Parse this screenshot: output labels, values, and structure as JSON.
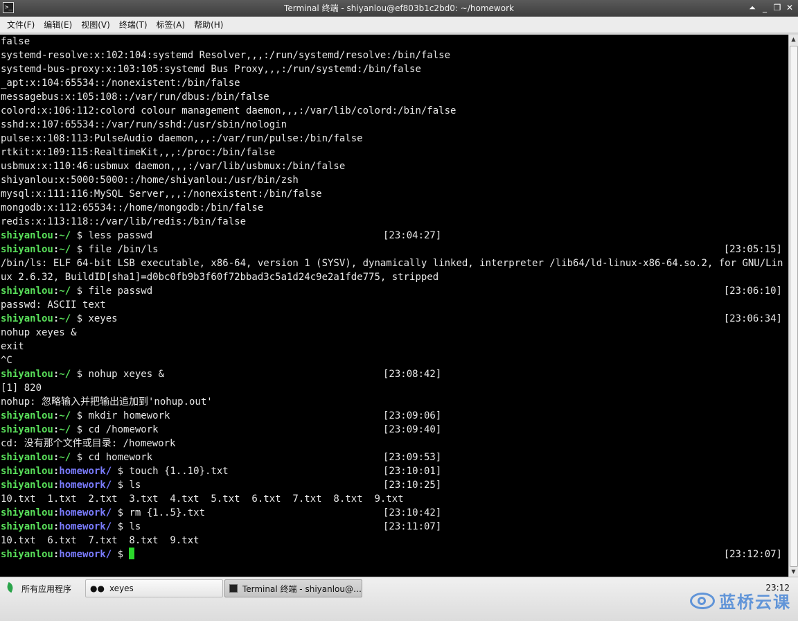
{
  "window": {
    "title": "Terminal 终端 - shiyanlou@ef803b1c2bd0: ~/homework",
    "icon": "terminal-icon",
    "controls": [
      "⏶",
      "_",
      "❐",
      "✕"
    ]
  },
  "menubar": {
    "items": [
      "文件(F)",
      "编辑(E)",
      "视图(V)",
      "终端(T)",
      "标签(A)",
      "帮助(H)"
    ]
  },
  "terminal": {
    "prompt_user": "shiyanlou",
    "prompt_sep": ":",
    "plain_lines": [
      "false",
      "systemd-resolve:x:102:104:systemd Resolver,,,:/run/systemd/resolve:/bin/false",
      "systemd-bus-proxy:x:103:105:systemd Bus Proxy,,,:/run/systemd:/bin/false",
      "_apt:x:104:65534::/nonexistent:/bin/false",
      "messagebus:x:105:108::/var/run/dbus:/bin/false",
      "colord:x:106:112:colord colour management daemon,,,:/var/lib/colord:/bin/false",
      "sshd:x:107:65534::/var/run/sshd:/usr/sbin/nologin",
      "pulse:x:108:113:PulseAudio daemon,,,:/var/run/pulse:/bin/false",
      "rtkit:x:109:115:RealtimeKit,,,:/proc:/bin/false",
      "usbmux:x:110:46:usbmux daemon,,,:/var/lib/usbmux:/bin/false",
      "shiyanlou:x:5000:5000::/home/shiyanlou:/usr/bin/zsh",
      "mysql:x:111:116:MySQL Server,,,:/nonexistent:/bin/false",
      "mongodb:x:112:65534::/home/mongodb:/bin/false",
      "redis:x:113:118::/var/lib/redis:/bin/false"
    ],
    "entries": [
      {
        "type": "prompt",
        "dir": "~/",
        "cmd": " $ less passwd",
        "ts": "[23:04:27]",
        "ts_pos": "mid"
      },
      {
        "type": "prompt",
        "dir": "~/",
        "cmd": " $ file /bin/ls",
        "ts": "[23:05:15]",
        "ts_pos": "right"
      },
      {
        "type": "wrap",
        "text": "/bin/ls: ELF 64-bit LSB executable, x86-64, version 1 (SYSV), dynamically linked, interpreter /lib64/ld-linux-x86-64.so.2, for GNU/Linux 2.6.32, BuildID[sha1]=d0bc0fb9b3f60f72bbad3c5a1d24c9e2a1fde775, stripped"
      },
      {
        "type": "prompt",
        "dir": "~/",
        "cmd": " $ file passwd",
        "ts": "[23:06:10]",
        "ts_pos": "right"
      },
      {
        "type": "out",
        "text": "passwd: ASCII text"
      },
      {
        "type": "prompt",
        "dir": "~/",
        "cmd": " $ xeyes",
        "ts": "[23:06:34]",
        "ts_pos": "right"
      },
      {
        "type": "out",
        "text": "nohup xeyes &"
      },
      {
        "type": "out",
        "text": "exit"
      },
      {
        "type": "out",
        "text": "^C"
      },
      {
        "type": "prompt",
        "dir": "~/",
        "cmd": " $ nohup xeyes &",
        "ts": "[23:08:42]",
        "ts_pos": "mid"
      },
      {
        "type": "out",
        "text": "[1] 820"
      },
      {
        "type": "out",
        "text": "nohup: 忽略输入并把输出追加到'nohup.out'"
      },
      {
        "type": "prompt",
        "dir": "~/",
        "cmd": " $ mkdir homework",
        "ts": "[23:09:06]",
        "ts_pos": "mid"
      },
      {
        "type": "prompt",
        "dir": "~/",
        "cmd": " $ cd /homework",
        "ts": "[23:09:40]",
        "ts_pos": "mid"
      },
      {
        "type": "out",
        "text": "cd: 没有那个文件或目录: /homework"
      },
      {
        "type": "prompt",
        "dir": "~/",
        "cmd": " $ cd homework",
        "ts": "[23:09:53]",
        "ts_pos": "mid"
      },
      {
        "type": "prompt",
        "dir": "homework/",
        "cmd": " $ touch {1..10}.txt",
        "ts": "[23:10:01]",
        "ts_pos": "mid",
        "dircolor": true
      },
      {
        "type": "prompt",
        "dir": "homework/",
        "cmd": " $ ls",
        "ts": "[23:10:25]",
        "ts_pos": "mid",
        "dircolor": true
      },
      {
        "type": "out",
        "text": "10.txt  1.txt  2.txt  3.txt  4.txt  5.txt  6.txt  7.txt  8.txt  9.txt"
      },
      {
        "type": "prompt",
        "dir": "homework/",
        "cmd": " $ rm {1..5}.txt",
        "ts": "[23:10:42]",
        "ts_pos": "mid",
        "dircolor": true
      },
      {
        "type": "prompt",
        "dir": "homework/",
        "cmd": " $ ls",
        "ts": "[23:11:07]",
        "ts_pos": "mid",
        "dircolor": true
      },
      {
        "type": "out",
        "text": "10.txt  6.txt  7.txt  8.txt  9.txt"
      },
      {
        "type": "prompt",
        "dir": "homework/",
        "cmd": " $ ",
        "ts": "[23:12:07]",
        "ts_pos": "right",
        "dircolor": true,
        "cursor": true
      }
    ],
    "colors": {
      "user": "#59e05a",
      "dir_home": "#59e05a",
      "dir_homework": "#7a7cff",
      "cursor": "#2bd82b",
      "background": "#000000"
    }
  },
  "taskbar": {
    "apps_menu": "所有应用程序",
    "tasks": [
      {
        "label": "xeyes",
        "icon": "eyes-icon"
      },
      {
        "label": "Terminal 终端 - shiyanlou@…",
        "icon": "terminal-icon",
        "active": true
      }
    ],
    "clock": "23:12",
    "watermark": "蓝桥云课"
  }
}
